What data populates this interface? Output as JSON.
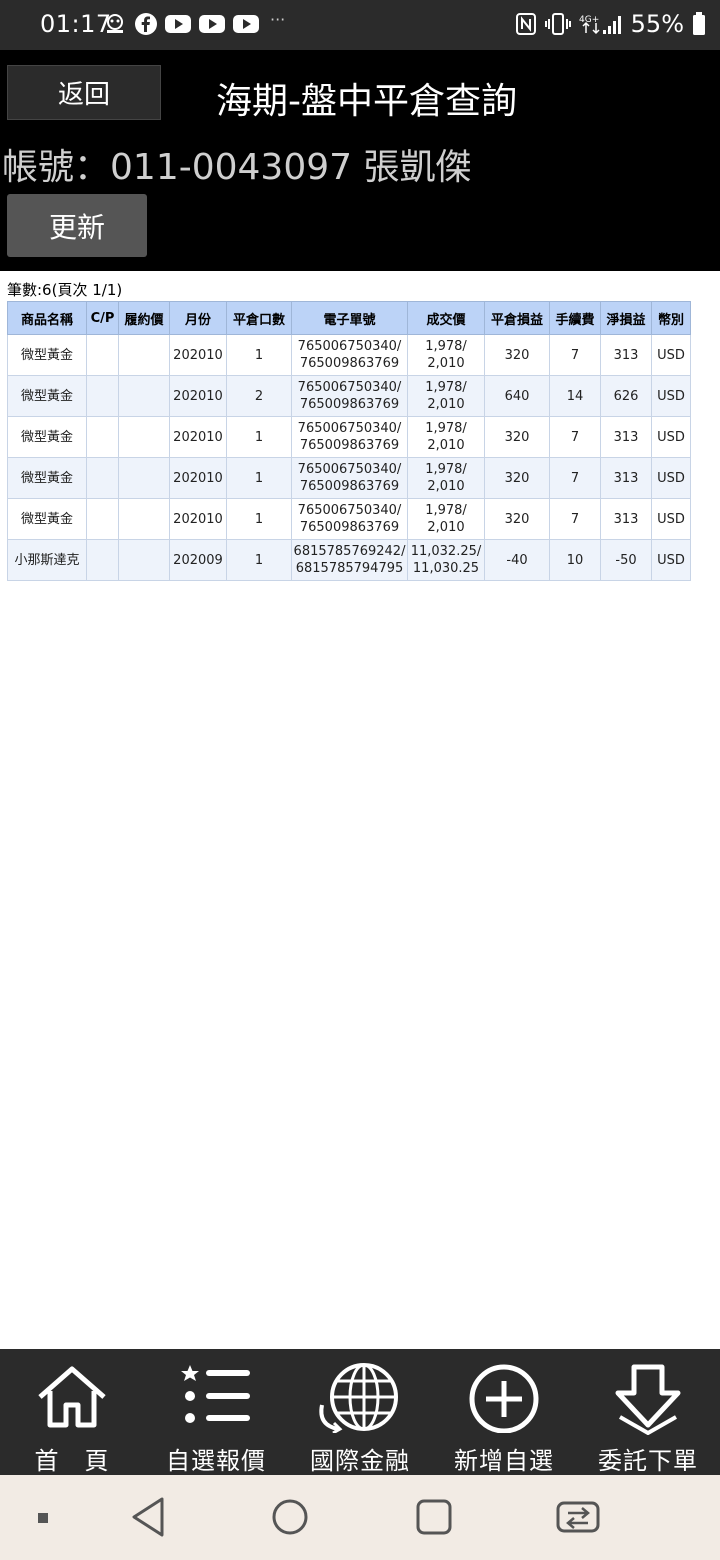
{
  "status_bar": {
    "time": "01:17",
    "battery": "55%",
    "dots": "···",
    "network": "4G",
    "icons": [
      "app-icon",
      "facebook-icon",
      "youtube-icon",
      "youtube-icon",
      "youtube-icon",
      "nfc-icon",
      "vibrate-icon",
      "signal-icon",
      "battery-icon"
    ]
  },
  "header": {
    "back_label": "返回",
    "title": "海期-盤中平倉查詢",
    "account_label": "帳號：",
    "account_value": "011-0043097 張凱傑",
    "refresh_label": "更新"
  },
  "summary": {
    "count_text": "筆數:6(頁次 1/1)"
  },
  "table": {
    "headers": [
      "商品名稱",
      "C/P",
      "履約價",
      "月份",
      "平倉口數",
      "電子單號",
      "成交價",
      "平倉損益",
      "手續費",
      "淨損益",
      "幣別"
    ],
    "rows": [
      {
        "product": "微型黃金",
        "cp": "",
        "strike": "",
        "month": "202010",
        "qty": "1",
        "order1": "765006750340/",
        "order2": "765009863769",
        "price1": "1,978/",
        "price2": "2,010",
        "pnl": "320",
        "fee": "7",
        "net": "313",
        "currency": "USD"
      },
      {
        "product": "微型黃金",
        "cp": "",
        "strike": "",
        "month": "202010",
        "qty": "2",
        "order1": "765006750340/",
        "order2": "765009863769",
        "price1": "1,978/",
        "price2": "2,010",
        "pnl": "640",
        "fee": "14",
        "net": "626",
        "currency": "USD"
      },
      {
        "product": "微型黃金",
        "cp": "",
        "strike": "",
        "month": "202010",
        "qty": "1",
        "order1": "765006750340/",
        "order2": "765009863769",
        "price1": "1,978/",
        "price2": "2,010",
        "pnl": "320",
        "fee": "7",
        "net": "313",
        "currency": "USD"
      },
      {
        "product": "微型黃金",
        "cp": "",
        "strike": "",
        "month": "202010",
        "qty": "1",
        "order1": "765006750340/",
        "order2": "765009863769",
        "price1": "1,978/",
        "price2": "2,010",
        "pnl": "320",
        "fee": "7",
        "net": "313",
        "currency": "USD"
      },
      {
        "product": "微型黃金",
        "cp": "",
        "strike": "",
        "month": "202010",
        "qty": "1",
        "order1": "765006750340/",
        "order2": "765009863769",
        "price1": "1,978/",
        "price2": "2,010",
        "pnl": "320",
        "fee": "7",
        "net": "313",
        "currency": "USD"
      },
      {
        "product": "小那斯達克",
        "cp": "",
        "strike": "",
        "month": "202009",
        "qty": "1",
        "order1": "6815785769242/",
        "order2": "6815785794795",
        "price1": "11,032.25/",
        "price2": "11,030.25",
        "pnl": "-40",
        "fee": "10",
        "net": "-50",
        "currency": "USD"
      }
    ]
  },
  "bottom_nav": [
    {
      "label": "首　頁",
      "icon": "home-icon"
    },
    {
      "label": "自選報價",
      "icon": "list-star-icon"
    },
    {
      "label": "國際金融",
      "icon": "globe-icon"
    },
    {
      "label": "新增自選",
      "icon": "plus-circle-icon"
    },
    {
      "label": "委託下單",
      "icon": "down-arrow-icon"
    }
  ],
  "colors": {
    "positive": "#d8262b",
    "negative": "#1e8f1e",
    "header_bg": "#bcd3f7",
    "product_link": "#2346a8"
  }
}
